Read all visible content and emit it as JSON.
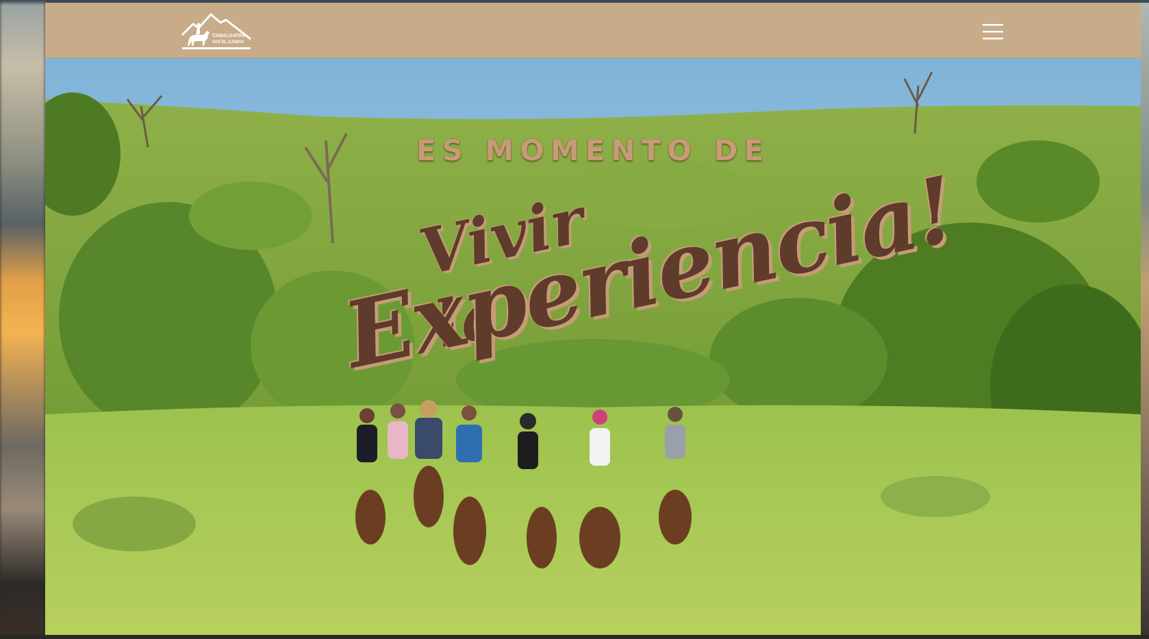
{
  "header": {
    "logo_text_line1": "CABALGATAS",
    "logo_text_line2": "VIVÍ EL CAMPO",
    "menu_icon": "hamburger-menu-icon"
  },
  "hero": {
    "kicker": "ES MOMENTO DE",
    "headline_line1": "Vivir la",
    "headline_line2": "Experiencia!",
    "image": "group-horseback-riding-in-green-hills"
  },
  "colors": {
    "header_bg": "#c8ac8a",
    "headline_brown": "#5e3b2b",
    "kicker_tan": "#c69c76"
  }
}
